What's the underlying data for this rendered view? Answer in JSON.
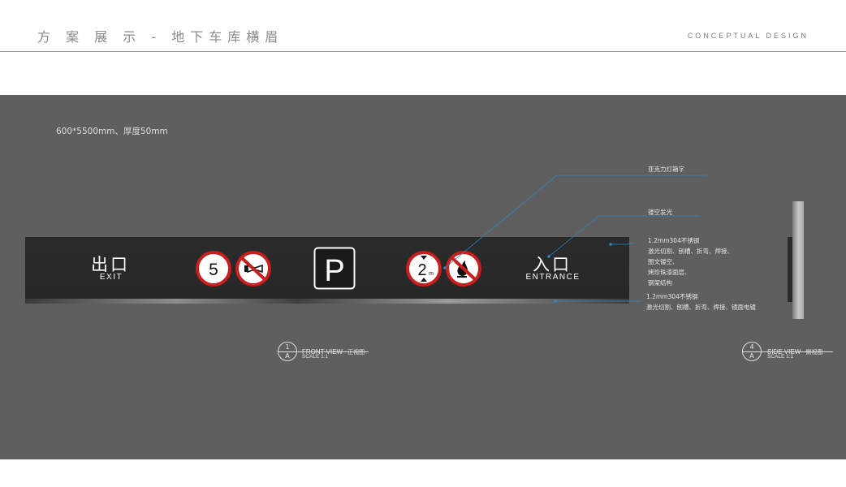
{
  "header": {
    "title": "方 案 展 示 - 地下车库横眉",
    "subtitle": "CONCEPTUAL DESIGN"
  },
  "drawing": {
    "dimensions": "600*5500mm、厚度50mm",
    "sign": {
      "exit_cn": "出口",
      "exit_en": "EXIT",
      "entrance_cn": "入口",
      "entrance_en": "ENTRANCE",
      "speed_limit": "5",
      "parking": "P",
      "height_limit": "2",
      "height_unit": "m"
    },
    "notes": {
      "acrylic": "亚克力灯箱字",
      "hollow_light": "镂空发光",
      "stainless_face_1": "1.2mm304不锈钢",
      "stainless_face_2": "激光切割、刨槽、折弯、焊接、",
      "stainless_face_3": "图文镂空、",
      "stainless_face_4": "烤珍珠漆面层、",
      "stainless_face_5": "钢架结构",
      "stainless_edge_1": "1.2mm304不锈钢",
      "stainless_edge_2": "激光切割、刨槽、折弯、焊接、镜面电镀"
    },
    "views": {
      "front": {
        "num_top": "1",
        "num_bottom": "A",
        "title": "FRONT VIEW",
        "cn": "正视图",
        "scale": "SCALE 1:1"
      },
      "side": {
        "num_top": "4",
        "num_bottom": "A",
        "title": "SIDE VIEW",
        "cn": "侧视图",
        "scale": "SCALE 1:1"
      }
    },
    "colors": {
      "panel": "#5f5f5f",
      "sign_face": "#272727",
      "prohibit_red": "#c81e1e",
      "leader_blue": "#2e86c1"
    }
  }
}
